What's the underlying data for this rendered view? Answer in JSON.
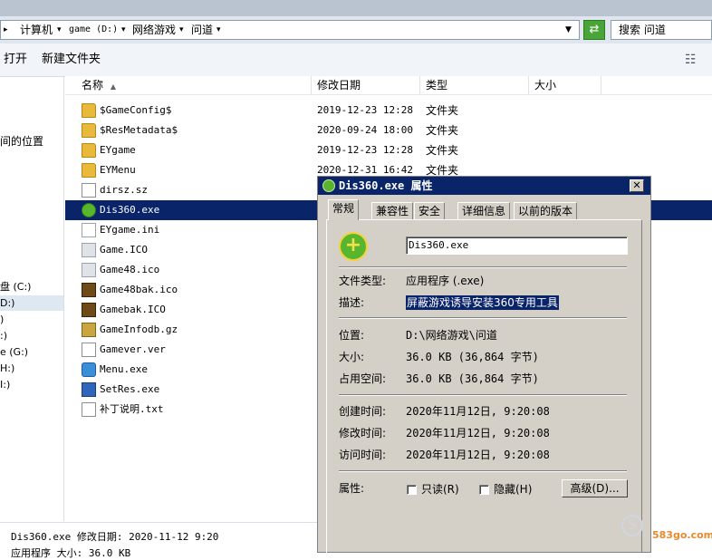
{
  "address": {
    "crumbs": [
      "计算机",
      "game (D:)",
      "网络游戏",
      "问道"
    ],
    "search_placeholder": "搜索 问道"
  },
  "toolbar": {
    "open_label": "打开",
    "new_folder_label": "新建文件夹"
  },
  "nav": {
    "items": [
      "间的位置",
      "盘 (C:)",
      "D:)",
      ")",
      ":)",
      "e (G:)",
      "H:)",
      "I:)"
    ]
  },
  "columns": {
    "name": "名称",
    "date": "修改日期",
    "type": "类型",
    "size": "大小"
  },
  "files": [
    {
      "name": "$GameConfig$",
      "date": "2019-12-23 12:28",
      "type": "文件夹",
      "icon": "folder-icon"
    },
    {
      "name": "$ResMetadata$",
      "date": "2020-09-24 18:00",
      "type": "文件夹",
      "icon": "folder-icon"
    },
    {
      "name": "EYgame",
      "date": "2019-12-23 12:28",
      "type": "文件夹",
      "icon": "folder-icon"
    },
    {
      "name": "EYMenu",
      "date": "2020-12-31 16:42",
      "type": "文件夹",
      "icon": "folder-icon"
    },
    {
      "name": "dirsz.sz",
      "date": "",
      "type": "",
      "icon": "document-icon"
    },
    {
      "name": "Dis360.exe",
      "date": "",
      "type": "",
      "icon": "app-360-icon"
    },
    {
      "name": "EYgame.ini",
      "date": "",
      "type": "",
      "icon": "config-file-icon"
    },
    {
      "name": "Game.ICO",
      "date": "",
      "type": "",
      "icon": "icon-file-icon"
    },
    {
      "name": "Game48.ico",
      "date": "",
      "type": "",
      "icon": "icon-file-icon"
    },
    {
      "name": "Game48bak.ico",
      "date": "",
      "type": "",
      "icon": "image-file-icon"
    },
    {
      "name": "Gamebak.ICO",
      "date": "",
      "type": "",
      "icon": "image-file-icon"
    },
    {
      "name": "GameInfodb.gz",
      "date": "",
      "type": "",
      "icon": "archive-icon"
    },
    {
      "name": "Gamever.ver",
      "date": "",
      "type": "",
      "icon": "document-icon"
    },
    {
      "name": "Menu.exe",
      "date": "",
      "type": "",
      "icon": "app-icon"
    },
    {
      "name": "SetRes.exe",
      "date": "",
      "type": "",
      "icon": "app-icon"
    },
    {
      "name": "补丁说明.txt",
      "date": "",
      "type": "",
      "icon": "text-file-icon"
    }
  ],
  "status": {
    "line1": "Dis360.exe 修改日期: 2020-11-12 9:20",
    "line2": "应用程序        大小: 36.0 KB"
  },
  "dialog": {
    "title": "Dis360.exe 属性",
    "close": "✕",
    "tabs": [
      "常规",
      "兼容性",
      "安全",
      "详细信息",
      "以前的版本"
    ],
    "file_name": "Dis360.exe",
    "labels": {
      "file_type": "文件类型:",
      "description": "描述:",
      "location": "位置:",
      "size": "大小:",
      "size_on_disk": "占用空间:",
      "created": "创建时间:",
      "modified": "修改时间:",
      "accessed": "访问时间:",
      "attributes": "属性:"
    },
    "values": {
      "file_type": "应用程序 (.exe)",
      "description": "屏蔽游戏诱导安装360专用工具",
      "location": "D:\\网络游戏\\问道",
      "size": "36.0 KB (36,864 字节)",
      "size_on_disk": "36.0 KB (36,864 字节)",
      "created": "2020年11月12日, 9:20:08",
      "modified": "2020年11月12日, 9:20:08",
      "accessed": "2020年11月12日, 9:20:08"
    },
    "attr_readonly": "只读(R)",
    "attr_hidden": "隐藏(H)",
    "advanced_button": "高级(D)..."
  },
  "watermark": "583go.com"
}
